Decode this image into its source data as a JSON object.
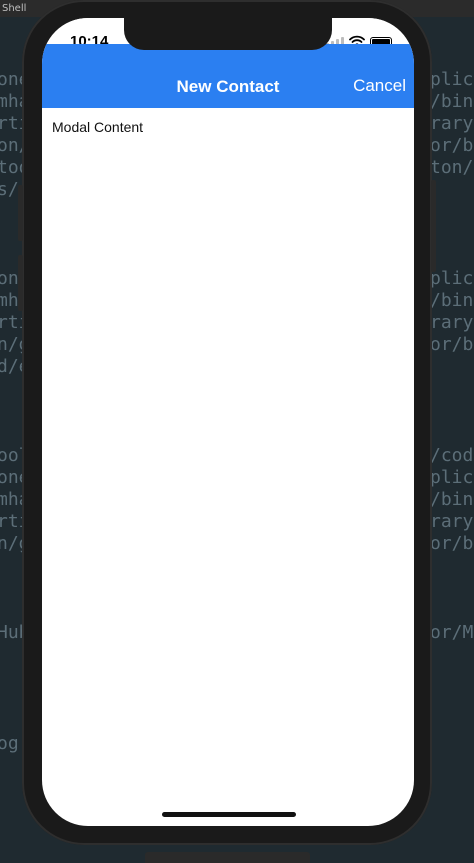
{
  "host_window": {
    "title": "Shell"
  },
  "background_code": {
    "left_fragments": [
      "one",
      "mha",
      "rti",
      "on/_",
      "too",
      "s/",
      "",
      "one",
      "mha",
      "rti",
      "n/g",
      "d/e",
      "",
      "",
      "ool",
      "one",
      "mha",
      "rti",
      "n/g",
      "",
      "",
      "Hub",
      "",
      "",
      "og"
    ],
    "right_fragments": [
      "plic",
      "/bin:",
      "rary,",
      "or/bi",
      "ton/C",
      "",
      "",
      "plic",
      "/bin:",
      "rary,",
      "or/b",
      "",
      "",
      "",
      "/code",
      "plic",
      "/bin:",
      "rary,",
      "or/b",
      "",
      "",
      "or/My",
      "",
      "",
      ""
    ]
  },
  "status_bar": {
    "time": "10:14"
  },
  "navbar": {
    "title": "New Contact",
    "cancel_label": "Cancel"
  },
  "content": {
    "text": "Modal Content"
  },
  "colors": {
    "accent": "#2b7ff1",
    "screen_bg": "#ffffff",
    "host_bg": "#1f2a30"
  }
}
